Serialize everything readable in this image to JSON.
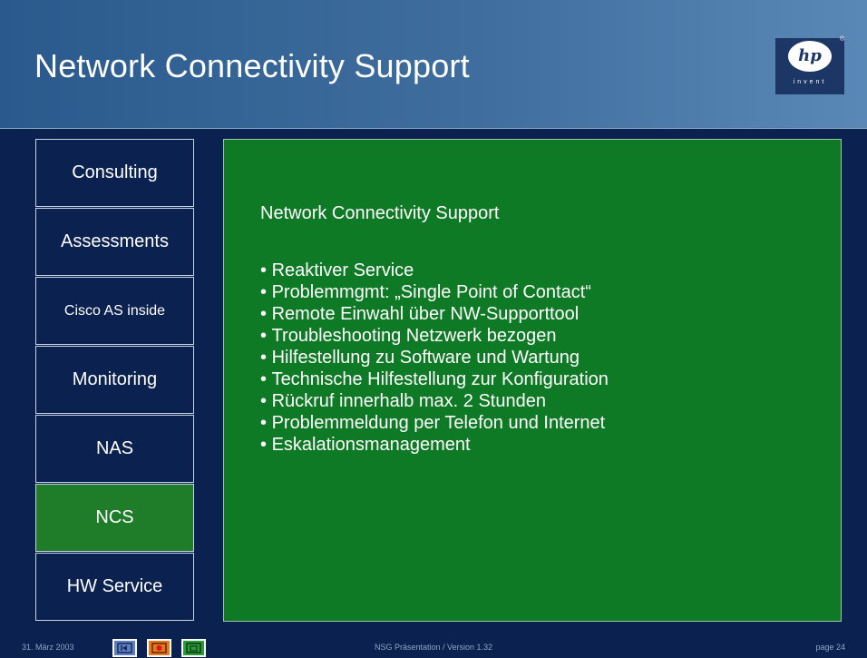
{
  "slide": {
    "title": "Network Connectivity Support"
  },
  "logo": {
    "letters": "hp",
    "tagline": "invent",
    "trademark": "®"
  },
  "nav": {
    "items": [
      {
        "label": "Consulting"
      },
      {
        "label": "Assessments"
      },
      {
        "label": "Cisco AS inside"
      },
      {
        "label": "Monitoring"
      },
      {
        "label": "NAS"
      },
      {
        "label": "NCS",
        "active": true
      },
      {
        "label": "HW Service"
      }
    ]
  },
  "content": {
    "heading": "Network Connectivity Support",
    "bullets": [
      "Reaktiver Service",
      "Problemmgmt: „Single Point of Contact“",
      "Remote Einwahl über NW-Supporttool",
      "Troubleshooting Netzwerk bezogen",
      "Hilfestellung zu Software  und Wartung",
      "Technische Hilfestellung zur Konfiguration",
      "Rückruf innerhalb max. 2 Stunden",
      "Problemmeldung per Telefon und Internet",
      "Eskalationsmanagement"
    ]
  },
  "footer": {
    "date": "31. März 2003",
    "center": "NSG Präsentation / Version 1.32",
    "page": "page 24",
    "buttons": [
      {
        "icon": "first-slide-icon",
        "color": "#5d7fbf"
      },
      {
        "icon": "stop-icon",
        "color": "#e8781e"
      },
      {
        "icon": "print-icon",
        "color": "#2a9a3a"
      }
    ]
  },
  "colors": {
    "background": "#0b2150",
    "header": "#3f6e9e",
    "content": "#0f7a25",
    "active_nav": "#1f7d2a"
  }
}
